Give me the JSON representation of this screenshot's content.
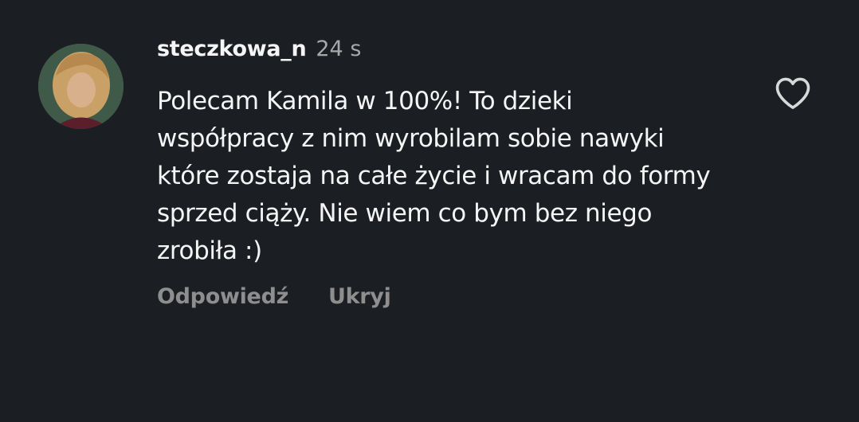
{
  "comment": {
    "username": "steczkowa_n",
    "timestamp": "24 s",
    "text": "Polecam Kamila w 100%! To dzieki współpracy z nim wyrobilam sobie nawyki które zostaja na całe życie i wracam do formy sprzed ciąży. Nie wiem co bym bez niego zrobiła :)",
    "avatar_icon": "profile-photo",
    "like_icon": "heart-outline-icon"
  },
  "actions": {
    "reply_label": "Odpowiedź",
    "hide_label": "Ukryj"
  },
  "colors": {
    "background": "#1b1e23",
    "primary_text": "#f5f5f5",
    "secondary_text": "#8e8e8e",
    "timestamp_text": "#a8a8a8"
  }
}
